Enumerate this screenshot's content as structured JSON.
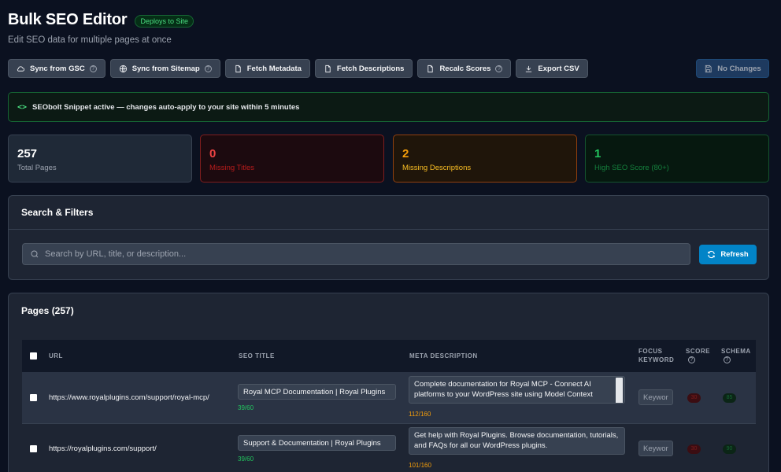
{
  "header": {
    "title": "Bulk SEO Editor",
    "badge": "Deploys to Site",
    "subtitle": "Edit SEO data for multiple pages at once"
  },
  "toolbar": {
    "buttons": [
      {
        "label": "Sync from GSC",
        "icon": "cloud-icon",
        "help": true
      },
      {
        "label": "Sync from Sitemap",
        "icon": "globe-icon",
        "help": true
      },
      {
        "label": "Fetch Metadata",
        "icon": "document-icon",
        "help": false
      },
      {
        "label": "Fetch Descriptions",
        "icon": "document-icon",
        "help": false
      },
      {
        "label": "Recalc Scores",
        "icon": "document-icon",
        "help": true
      },
      {
        "label": "Export CSV",
        "icon": "download-icon",
        "help": false
      }
    ],
    "save_label": "No Changes",
    "help_glyph": "?"
  },
  "snippet": {
    "text": "SEObolt Snippet active — changes auto-apply to your site within 5 minutes",
    "icon_glyph": "<>"
  },
  "stats": [
    {
      "value": "257",
      "label": "Total Pages"
    },
    {
      "value": "0",
      "label": "Missing Titles"
    },
    {
      "value": "2",
      "label": "Missing Descriptions"
    },
    {
      "value": "1",
      "label": "High SEO Score (80+)"
    }
  ],
  "filters": {
    "title": "Search & Filters",
    "search_placeholder": "Search by URL, title, or description...",
    "refresh_label": "Refresh"
  },
  "pages": {
    "title": "Pages (257)",
    "columns": {
      "url": "URL",
      "seo_title": "SEO TITLE",
      "meta_description": "META DESCRIPTION",
      "focus_keyword_1": "FOCUS",
      "focus_keyword_2": "KEYWORD",
      "score": "SCORE",
      "schema": "SCHEMA"
    },
    "rows": [
      {
        "url": "https://www.royalplugins.com/support/royal-mcp/",
        "title": "Royal MCP Documentation | Royal Plugins",
        "title_count": "39/60",
        "description": "Complete documentation for Royal MCP - Connect AI platforms to your WordPress site using Model Context",
        "desc_count": "112/160",
        "keyword_placeholder": "Keywor",
        "score": "30",
        "schema": "85"
      },
      {
        "url": "https://royalplugins.com/support/",
        "title": "Support & Documentation | Royal Plugins",
        "title_count": "39/60",
        "description": "Get help with Royal Plugins. Browse documentation, tutorials, and FAQs for all our WordPress plugins.",
        "desc_count": "101/160",
        "keyword_placeholder": "Keywor",
        "score": "30",
        "schema": "90"
      }
    ]
  },
  "colors": {
    "background": "#0b1120",
    "accent": "#0284c7",
    "success": "#22c55e",
    "danger": "#ef4444",
    "warning": "#f59e0b"
  }
}
